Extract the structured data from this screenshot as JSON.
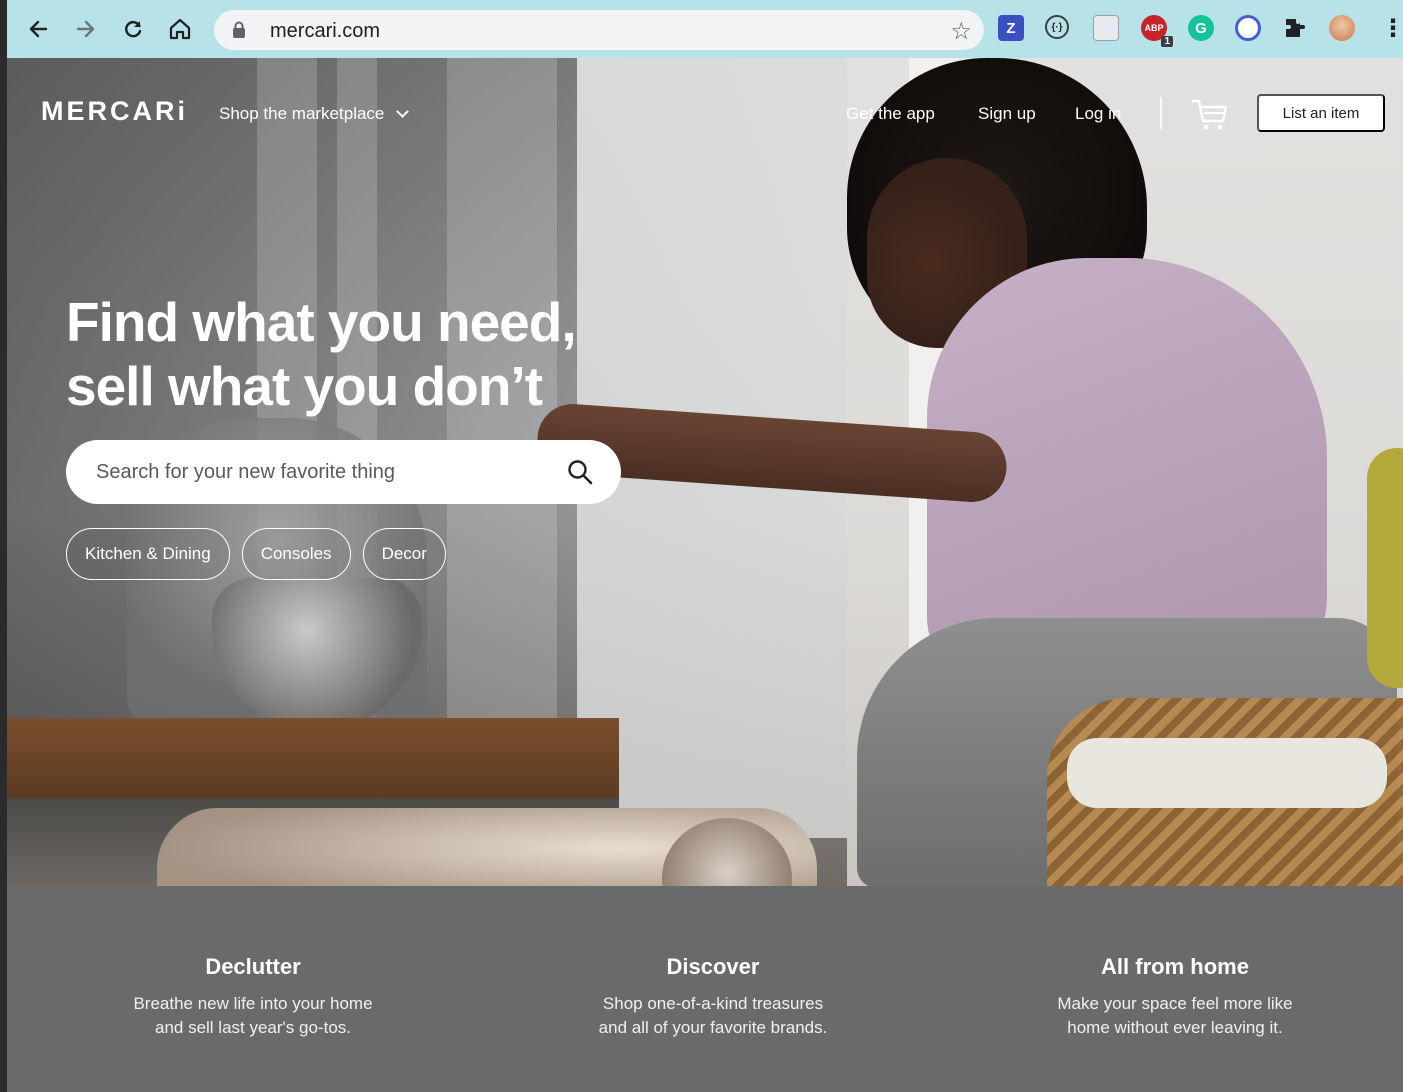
{
  "browser": {
    "url": "mercari.com",
    "extensions": [
      {
        "name": "z-extension",
        "label": "Z",
        "color": "#3a4fc1"
      },
      {
        "name": "code-extension",
        "label": "{·}",
        "color": "#5f6368"
      },
      {
        "name": "notes-extension",
        "label": "",
        "color": "#9aa0a6"
      },
      {
        "name": "adblock-extension",
        "label": "ABP",
        "badge": "1",
        "color": "#c8222b"
      },
      {
        "name": "grammarly-extension",
        "label": "G",
        "color": "#15c39a"
      },
      {
        "name": "privacy-extension",
        "label": "",
        "color": "#4a5bd6"
      }
    ]
  },
  "nav": {
    "logo": "MERCARi",
    "shop_label": "Shop the marketplace",
    "get_app": "Get the app",
    "sign_up": "Sign up",
    "log_in": "Log in",
    "list_item": "List an item"
  },
  "hero": {
    "headline_1": "Find what you need,",
    "headline_2": "sell what you don’t",
    "search_placeholder": "Search for your new favorite thing",
    "chips": [
      "Kitchen & Dining",
      "Consoles",
      "Decor"
    ]
  },
  "features": [
    {
      "title": "Declutter",
      "line1": "Breathe new life into your home",
      "line2": "and sell last year's go-tos."
    },
    {
      "title": "Discover",
      "line1": "Shop one-of-a-kind treasures",
      "line2": "and all of your favorite brands."
    },
    {
      "title": "All from home",
      "line1": "Make your space feel more like",
      "line2": "home without ever leaving it."
    }
  ],
  "colors": {
    "toolbar": "#b7e2e8",
    "band": "#6a6a6a",
    "cta_bg": "#ffffff"
  }
}
